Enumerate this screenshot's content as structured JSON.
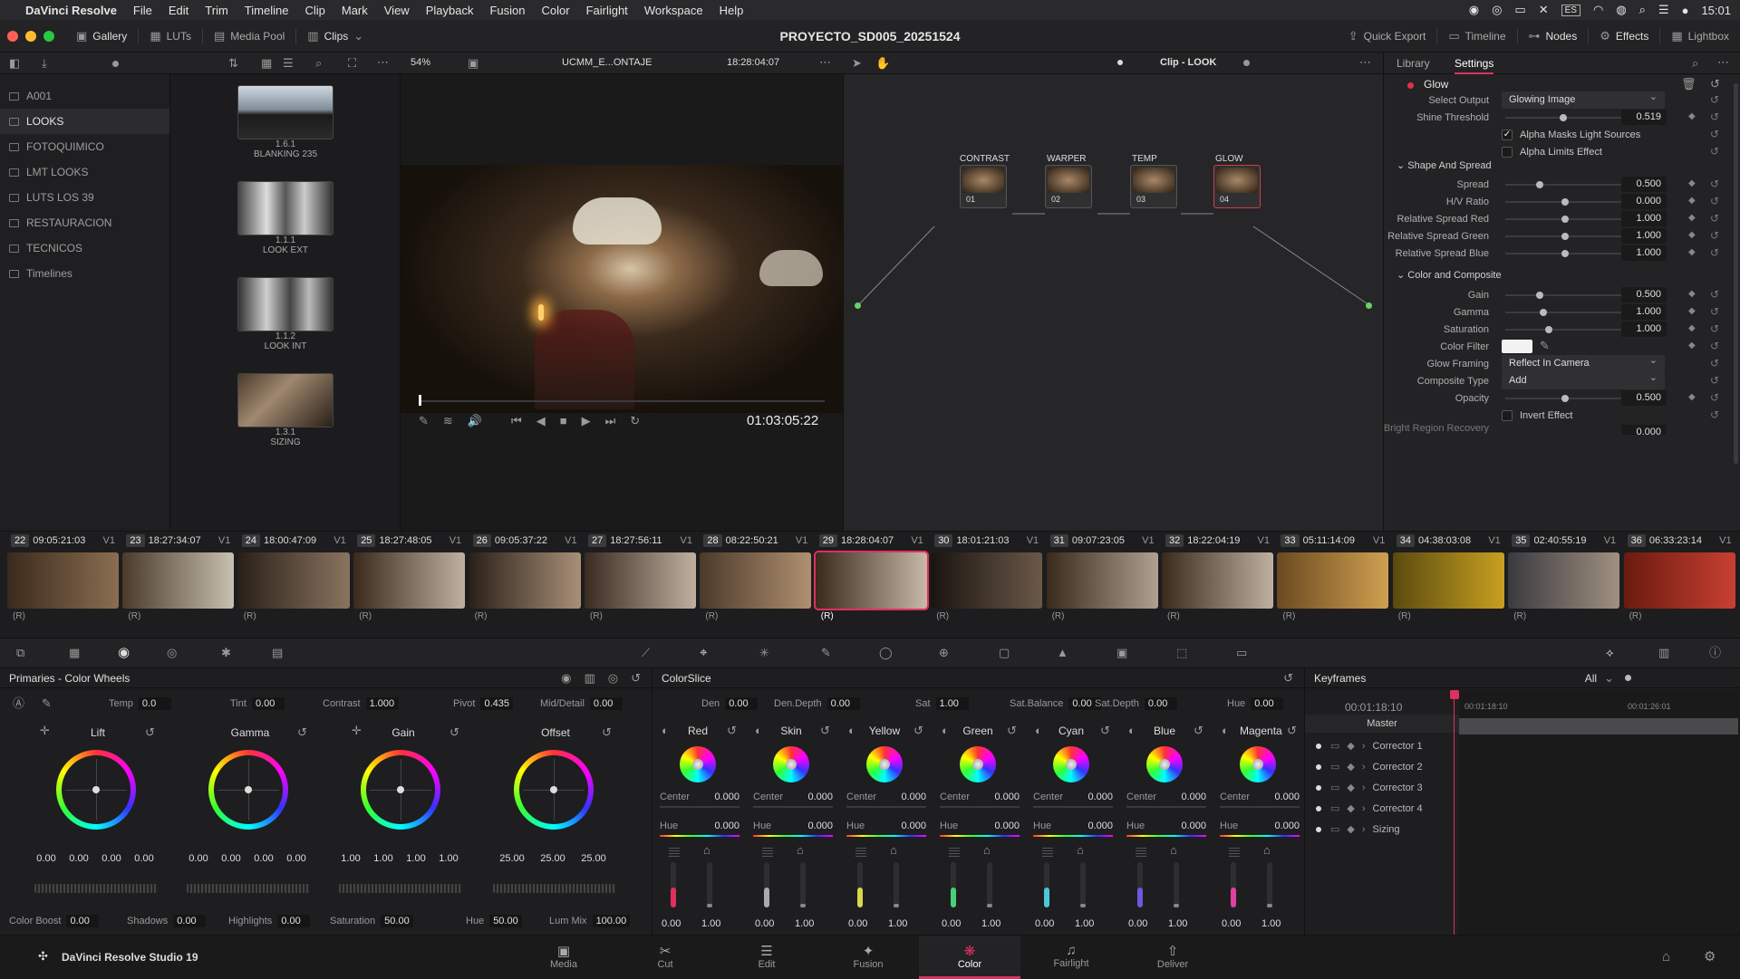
{
  "mac_menu": {
    "app": "DaVinci Resolve",
    "items": [
      "File",
      "Edit",
      "Trim",
      "Timeline",
      "Clip",
      "Mark",
      "View",
      "Playback",
      "Fusion",
      "Color",
      "Fairlight",
      "Workspace",
      "Help"
    ],
    "lang": "ES",
    "time": "15:01"
  },
  "titlebar": {
    "project": "PROYECTO_SD005_20251524",
    "left_tabs": [
      "Gallery",
      "LUTs",
      "Media Pool",
      "Clips"
    ],
    "right_tabs": [
      "Quick Export",
      "Timeline",
      "Nodes",
      "Effects",
      "Lightbox"
    ]
  },
  "viewer": {
    "zoom": "54%",
    "clip_name": "UCMM_E...ONTAJE",
    "timecode": "18:28:04:07",
    "playhead_tc": "01:03:05:22"
  },
  "nodes": {
    "title": "Clip - LOOK",
    "items": [
      {
        "label": "CONTRAST",
        "num": "01"
      },
      {
        "label": "WARPER",
        "num": "02"
      },
      {
        "label": "TEMP",
        "num": "03"
      },
      {
        "label": "GLOW",
        "num": "04"
      }
    ]
  },
  "sidebar": {
    "items": [
      "A001",
      "LOOKS",
      "FOTOQUIMICO",
      "LMT LOOKS",
      "LUTS LOS 39",
      "RESTAURACION",
      "TECNICOS",
      "Timelines"
    ]
  },
  "gallery": {
    "stills": [
      {
        "id": "1.6.1",
        "name": "BLANKING 235"
      },
      {
        "id": "1.1.1",
        "name": "LOOK EXT"
      },
      {
        "id": "1.1.2",
        "name": "LOOK INT"
      },
      {
        "id": "1.3.1",
        "name": "SIZING"
      }
    ]
  },
  "settings": {
    "tabs": [
      "Library",
      "Settings"
    ],
    "effect": "Glow",
    "select_output_label": "Select Output",
    "select_output": "Glowing Image",
    "shine_label": "Shine Threshold",
    "shine": "0.519",
    "alpha_masks": "Alpha Masks Light Sources",
    "alpha_limits": "Alpha Limits Effect",
    "section_shape": "Shape And Spread",
    "spread_label": "Spread",
    "spread": "0.500",
    "hv_label": "H/V Ratio",
    "hv": "0.000",
    "rsr_label": "Relative Spread Red",
    "rsr": "1.000",
    "rsg_label": "Relative Spread Green",
    "rsg": "1.000",
    "rsb_label": "Relative Spread Blue",
    "rsb": "1.000",
    "section_color": "Color and Composite",
    "gain_label": "Gain",
    "gain": "0.500",
    "gamma_label": "Gamma",
    "gamma": "1.000",
    "sat_label": "Saturation",
    "sat": "1.000",
    "filter_label": "Color Filter",
    "framing_label": "Glow Framing",
    "framing": "Reflect In Camera",
    "composite_label": "Composite Type",
    "composite": "Add",
    "opacity_label": "Opacity",
    "opacity": "0.500",
    "invert": "Invert Effect",
    "bright_label": "Bright Region Recovery",
    "bright": "0.000"
  },
  "clips": [
    {
      "n": "22",
      "tc": "09:05:21:03",
      "v": "V1"
    },
    {
      "n": "23",
      "tc": "18:27:34:07",
      "v": "V1"
    },
    {
      "n": "24",
      "tc": "18:00:47:09",
      "v": "V1"
    },
    {
      "n": "25",
      "tc": "18:27:48:05",
      "v": "V1"
    },
    {
      "n": "26",
      "tc": "09:05:37:22",
      "v": "V1"
    },
    {
      "n": "27",
      "tc": "18:27:56:11",
      "v": "V1"
    },
    {
      "n": "28",
      "tc": "08:22:50:21",
      "v": "V1"
    },
    {
      "n": "29",
      "tc": "18:28:04:07",
      "v": "V1"
    },
    {
      "n": "30",
      "tc": "18:01:21:03",
      "v": "V1"
    },
    {
      "n": "31",
      "tc": "09:07:23:05",
      "v": "V1"
    },
    {
      "n": "32",
      "tc": "18:22:04:19",
      "v": "V1"
    },
    {
      "n": "33",
      "tc": "05:11:14:09",
      "v": "V1"
    },
    {
      "n": "34",
      "tc": "04:38:03:08",
      "v": "V1"
    },
    {
      "n": "35",
      "tc": "02:40:55:19",
      "v": "V1"
    },
    {
      "n": "36",
      "tc": "06:33:23:14",
      "v": "V1"
    }
  ],
  "clip_tag": "(R)",
  "primaries": {
    "title": "Primaries - Color Wheels",
    "temp_label": "Temp",
    "temp": "0.0",
    "tint_label": "Tint",
    "tint": "0.00",
    "contrast_label": "Contrast",
    "contrast": "1.000",
    "pivot_label": "Pivot",
    "pivot": "0.435",
    "md_label": "Mid/Detail",
    "md": "0.00",
    "wheels": [
      {
        "name": "Lift",
        "vals": [
          "0.00",
          "0.00",
          "0.00",
          "0.00"
        ]
      },
      {
        "name": "Gamma",
        "vals": [
          "0.00",
          "0.00",
          "0.00",
          "0.00"
        ]
      },
      {
        "name": "Gain",
        "vals": [
          "1.00",
          "1.00",
          "1.00",
          "1.00"
        ]
      },
      {
        "name": "Offset",
        "vals": [
          "25.00",
          "25.00",
          "25.00"
        ]
      }
    ],
    "cb_label": "Color Boost",
    "cb": "0.00",
    "sh_label": "Shadows",
    "sh": "0.00",
    "hl_label": "Highlights",
    "hl": "0.00",
    "sat_label": "Saturation",
    "sat": "50.00",
    "hue_label": "Hue",
    "hue": "50.00",
    "lm_label": "Lum Mix",
    "lm": "100.00"
  },
  "colorslice": {
    "title": "ColorSlice",
    "den_label": "Den",
    "den": "0.00",
    "dd_label": "Den.Depth",
    "dd": "0.00",
    "sat_label": "Sat",
    "sat": "1.00",
    "sb_label": "Sat.Balance",
    "sb": "0.00",
    "sd_label": "Sat.Depth",
    "sd": "0.00",
    "hue_label": "Hue",
    "hue": "0.00",
    "center_label": "Center",
    "hue_row_label": "Hue",
    "slices": [
      {
        "name": "Red",
        "c": "0.000",
        "h": "0.000",
        "a": "0.00",
        "b": "1.00",
        "col": "#e0305e"
      },
      {
        "name": "Skin",
        "c": "0.000",
        "h": "0.000",
        "a": "0.00",
        "b": "1.00",
        "col": "#aaaaaa"
      },
      {
        "name": "Yellow",
        "c": "0.000",
        "h": "0.000",
        "a": "0.00",
        "b": "1.00",
        "col": "#d8d84a"
      },
      {
        "name": "Green",
        "c": "0.000",
        "h": "0.000",
        "a": "0.00",
        "b": "1.00",
        "col": "#4ad07a"
      },
      {
        "name": "Cyan",
        "c": "0.000",
        "h": "0.000",
        "a": "0.00",
        "b": "1.00",
        "col": "#4ac8d8"
      },
      {
        "name": "Blue",
        "c": "0.000",
        "h": "0.000",
        "a": "0.00",
        "b": "1.00",
        "col": "#6a5ae0"
      },
      {
        "name": "Magenta",
        "c": "0.000",
        "h": "0.000",
        "a": "0.00",
        "b": "1.00",
        "col": "#e040a0"
      }
    ]
  },
  "keyframes": {
    "title": "Keyframes",
    "filter": "All",
    "tc": "00:01:18:10",
    "ruler_a": "00:01:18:10",
    "ruler_b": "00:01:26:01",
    "master": "Master",
    "rows": [
      "Corrector 1",
      "Corrector 2",
      "Corrector 3",
      "Corrector 4",
      "Sizing"
    ]
  },
  "bottom": {
    "brand": "DaVinci Resolve Studio 19",
    "pages": [
      "Media",
      "Cut",
      "Edit",
      "Fusion",
      "Color",
      "Fairlight",
      "Deliver"
    ],
    "selected": "Color"
  },
  "colors": {
    "accent": "#e0305e",
    "node_border": "#d23c4a"
  }
}
